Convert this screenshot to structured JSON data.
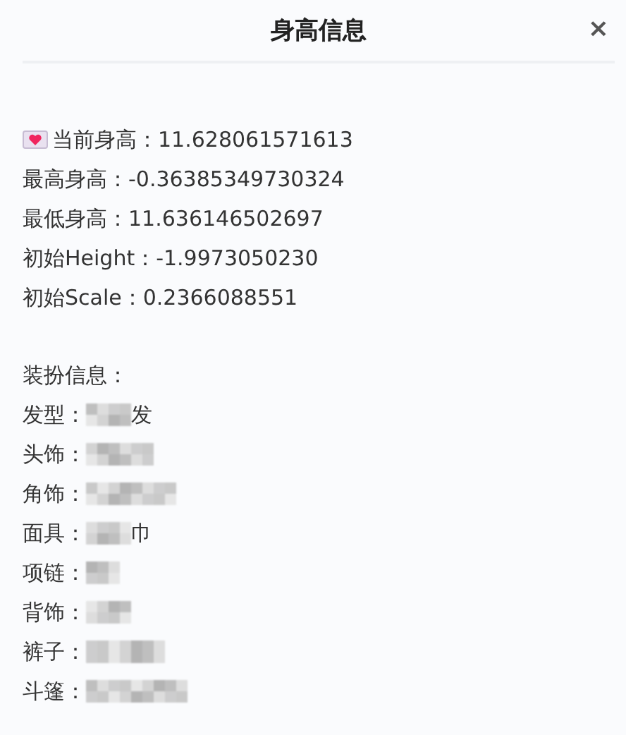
{
  "dialog": {
    "title": "身高信息",
    "close": "×"
  },
  "height_info": [
    {
      "text": "当前身高：11.628061571613",
      "kind": "with_icon"
    },
    {
      "text": "最高身高：-0.36385349730324"
    },
    {
      "text": "最低身高：11.636146502697"
    },
    {
      "text": "初始Height：-1.9973050230"
    },
    {
      "text": "初始Scale：0.2366088551"
    }
  ],
  "outfit": {
    "heading": "装扮信息：",
    "items": [
      {
        "label": "发型：",
        "tail": "发"
      },
      {
        "label": "头饰："
      },
      {
        "label": "角饰："
      },
      {
        "label": "面具：",
        "tail": "巾"
      },
      {
        "label": "项链："
      },
      {
        "label": "背饰："
      },
      {
        "label": "裤子："
      },
      {
        "label": "斗篷："
      }
    ]
  }
}
